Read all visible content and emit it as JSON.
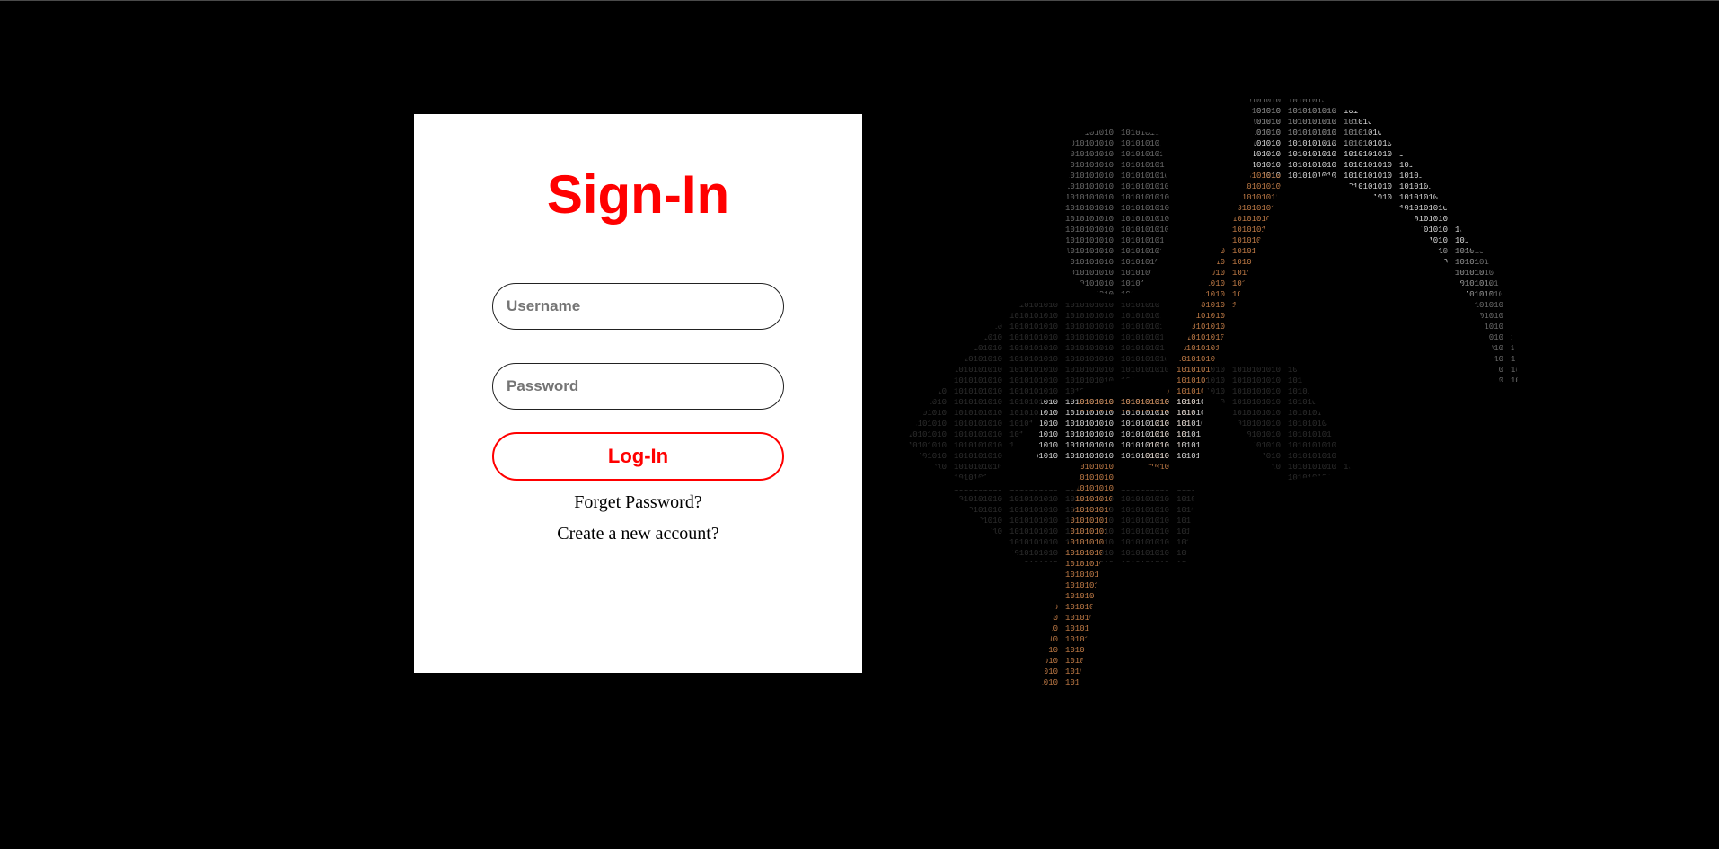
{
  "page": {
    "background_color": "#000000"
  },
  "signin": {
    "title": "Sign-In",
    "title_color": "#ff0000",
    "username": {
      "placeholder": "Username",
      "value": ""
    },
    "password": {
      "placeholder": "Password",
      "value": ""
    },
    "login_button_label": "Log-In",
    "forget_password_link": "Forget Password?",
    "create_account_link": "Create a new account?"
  },
  "decoration": {
    "binary_art_icon": "binary-code-logo-icon",
    "binary_pattern": "1010101010101010101010101010101010",
    "binary_colors": [
      "#ffffff",
      "#c8743a",
      "#555555"
    ]
  }
}
